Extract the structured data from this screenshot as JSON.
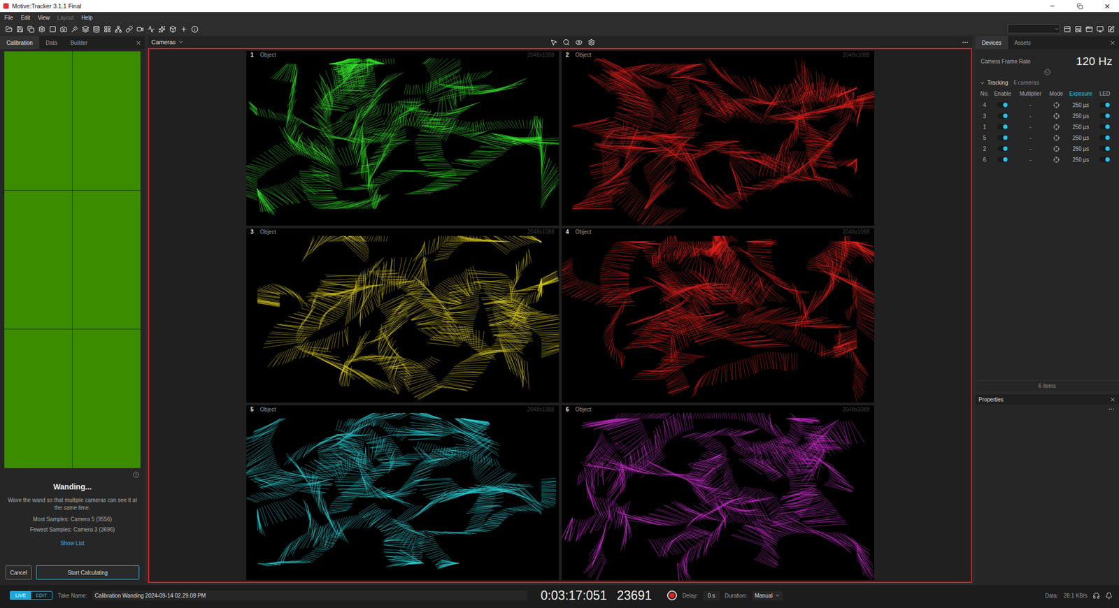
{
  "window": {
    "title": "Motive:Tracker 3.1.1 Final"
  },
  "menu": [
    {
      "label": "File",
      "disabled": false
    },
    {
      "label": "Edit",
      "disabled": false
    },
    {
      "label": "View",
      "disabled": false
    },
    {
      "label": "Layout",
      "disabled": true
    },
    {
      "label": "Help",
      "disabled": false
    }
  ],
  "left_panel": {
    "tabs": [
      {
        "label": "Calibration",
        "selected": true
      },
      {
        "label": "Data",
        "selected": false
      },
      {
        "label": "Builder",
        "selected": false
      }
    ]
  },
  "calibration": {
    "coverage": [
      {
        "covered": true
      },
      {
        "covered": true
      },
      {
        "covered": true
      },
      {
        "covered": true
      },
      {
        "covered": true
      },
      {
        "covered": true
      }
    ],
    "status": "Wanding...",
    "hint": "Wave the wand so that multiple cameras can see it at the same time.",
    "most_samples": "Most Samples: Camera 5 (9556)",
    "fewest_samples": "Fewest Samples: Camera 3 (3696)",
    "link": "Show List",
    "cancel": "Cancel",
    "start": "Start Calculating"
  },
  "viewport": {
    "menu": "Cameras",
    "cameras": [
      {
        "number": "1",
        "mode": "Object",
        "resolution": "2048x1088",
        "color": "#35e52a"
      },
      {
        "number": "2",
        "mode": "Object",
        "resolution": "2048x1088",
        "color": "#e8231f"
      },
      {
        "number": "3",
        "mode": "Object",
        "resolution": "2048x1088",
        "color": "#dccb1c"
      },
      {
        "number": "4",
        "mode": "Object",
        "resolution": "2048x1088",
        "color": "#e8231f"
      },
      {
        "number": "5",
        "mode": "Object",
        "resolution": "2048x1088",
        "color": "#2ad4d8"
      },
      {
        "number": "6",
        "mode": "Object",
        "resolution": "2048x1088",
        "color": "#d42fd6"
      }
    ]
  },
  "devices": {
    "tabs": [
      {
        "label": "Devices",
        "selected": true
      },
      {
        "label": "Assets",
        "selected": false
      }
    ],
    "frame_rate_label": "Camera Frame Rate",
    "frame_rate": "120 Hz",
    "group": "Tracking",
    "group_count": "6 cameras",
    "expanded": true,
    "columns": [
      {
        "label": "No.",
        "highlighted": false
      },
      {
        "label": "Enable",
        "highlighted": false
      },
      {
        "label": "Multiplier",
        "highlighted": false
      },
      {
        "label": "Mode",
        "highlighted": false
      },
      {
        "label": "Exposure",
        "highlighted": true
      },
      {
        "label": "LED",
        "highlighted": false
      }
    ],
    "rows": [
      {
        "no": "4",
        "enabled": true,
        "multiplier": "-",
        "exposure": "250 µs",
        "led": true
      },
      {
        "no": "3",
        "enabled": true,
        "multiplier": "-",
        "exposure": "250 µs",
        "led": true
      },
      {
        "no": "1",
        "enabled": true,
        "multiplier": "-",
        "exposure": "250 µs",
        "led": true
      },
      {
        "no": "5",
        "enabled": true,
        "multiplier": "-",
        "exposure": "250 µs",
        "led": true
      },
      {
        "no": "2",
        "enabled": true,
        "multiplier": "-",
        "exposure": "250 µs",
        "led": true
      },
      {
        "no": "6",
        "enabled": true,
        "multiplier": "-",
        "exposure": "250 µs",
        "led": true
      }
    ],
    "footer": "6 items"
  },
  "properties": {
    "title": "Properties"
  },
  "status_bar": {
    "modes": [
      {
        "label": "LIVE",
        "selected": true
      },
      {
        "label": "EDIT",
        "selected": false
      }
    ],
    "take_label": "Take Name:",
    "take_name": "Calibration Wanding 2024-09-14 02.29.08 PM",
    "timecode": "0:03:17:051",
    "frame": "23691",
    "delay_label": "Delay:",
    "delay": "0 s",
    "duration_label": "Duration:",
    "duration": "Manual",
    "data_label": "Data:",
    "data_rate": "28.1 KB/s"
  }
}
